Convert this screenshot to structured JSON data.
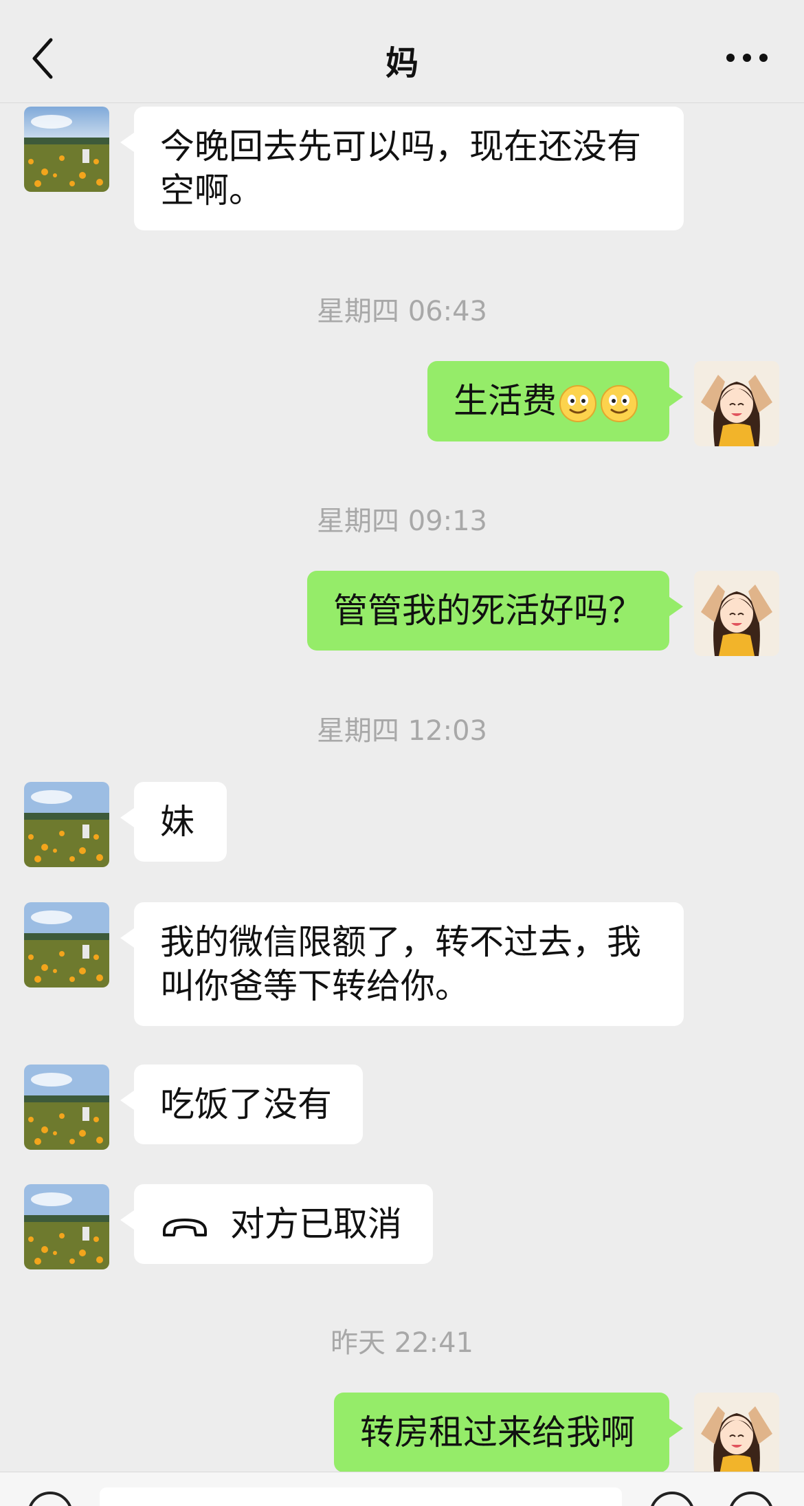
{
  "header": {
    "title": "妈"
  },
  "messages": {
    "m1": "今晚回去先可以吗，现在还没有空啊。",
    "m2": "生活费",
    "m3": "管管我的死活好吗？",
    "m4": "妹",
    "m5": "我的微信限额了，转不过去，我叫你爸等下转给你。",
    "m6": "吃饭了没有",
    "m7": "对方已取消",
    "m8": "转房租过来给我啊"
  },
  "timestamps": {
    "t1": "星期四 06:43",
    "t2": "星期四 09:13",
    "t3": "星期四 12:03",
    "t4": "昨天 22:41"
  },
  "icons": {
    "back": "chevron-left-icon",
    "more": "more-horizontal-icon",
    "emoji": "slightly-smiling-face-emoji",
    "call": "phone-hangup-icon"
  },
  "colors": {
    "background": "#ededed",
    "sent_bubble": "#95ec69",
    "received_bubble": "#ffffff",
    "timestamp_text": "#a8a8a8"
  }
}
